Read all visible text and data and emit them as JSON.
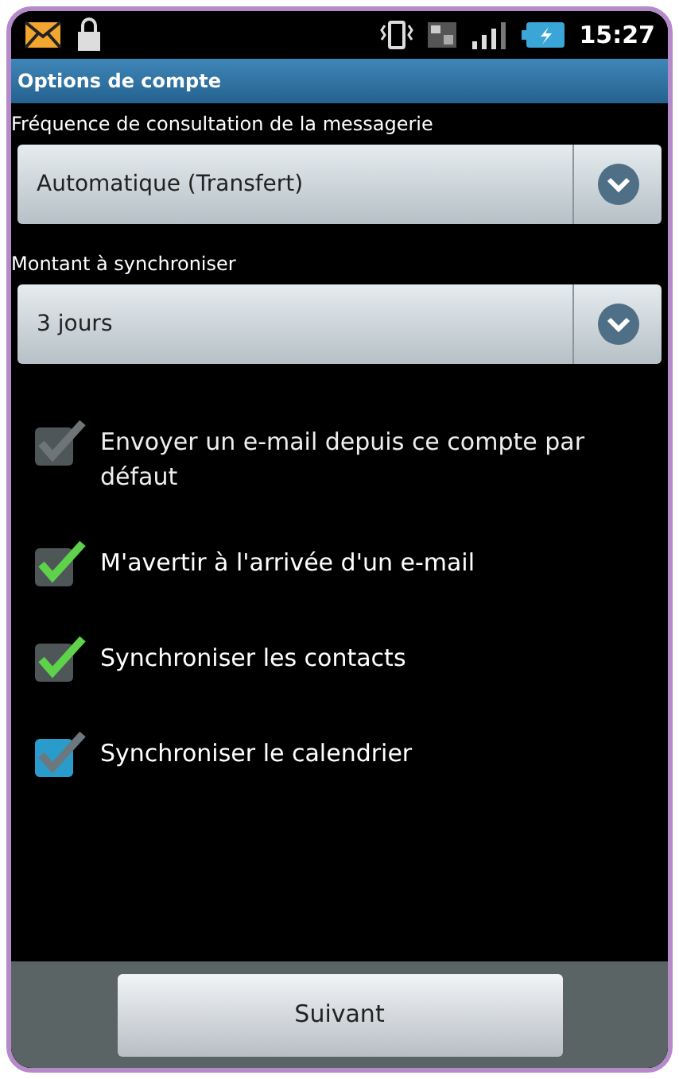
{
  "status_bar": {
    "time": "15:27"
  },
  "title_bar": {
    "title": "Options de compte"
  },
  "fields": [
    {
      "label": "Fréquence de consultation de la messagerie",
      "value": "Automatique (Transfert)"
    },
    {
      "label": "Montant à synchroniser",
      "value": "3 jours"
    }
  ],
  "options": [
    {
      "label": "Envoyer un e-mail depuis ce compte par défaut",
      "checked": true,
      "disabled": true,
      "focused": false
    },
    {
      "label": "M'avertir à l'arrivée d'un e-mail",
      "checked": true,
      "disabled": false,
      "focused": false
    },
    {
      "label": "Synchroniser les contacts",
      "checked": true,
      "disabled": false,
      "focused": false
    },
    {
      "label": "Synchroniser le calendrier",
      "checked": true,
      "disabled": false,
      "focused": true
    }
  ],
  "footer": {
    "button": "Suivant"
  }
}
